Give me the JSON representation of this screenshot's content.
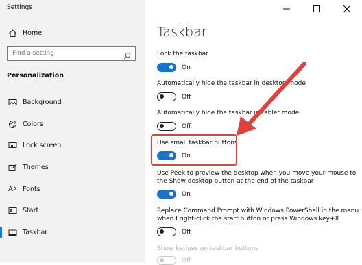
{
  "app": {
    "title": "Settings"
  },
  "sidebar": {
    "home_label": "Home",
    "search_placeholder": "Find a setting",
    "section_label": "Personalization",
    "items": [
      {
        "label": "Background",
        "icon": "image-icon"
      },
      {
        "label": "Colors",
        "icon": "palette-icon"
      },
      {
        "label": "Lock screen",
        "icon": "monitor-icon"
      },
      {
        "label": "Themes",
        "icon": "brush-icon"
      },
      {
        "label": "Fonts",
        "icon": "font-icon"
      },
      {
        "label": "Start",
        "icon": "start-icon"
      },
      {
        "label": "Taskbar",
        "icon": "taskbar-icon",
        "active": true
      }
    ]
  },
  "window_controls": [
    "minimize",
    "maximize",
    "close"
  ],
  "main": {
    "title": "Taskbar",
    "settings": [
      {
        "label": "Lock the taskbar",
        "state": "On"
      },
      {
        "label": "Automatically hide the taskbar in desktop mode",
        "state": "Off"
      },
      {
        "label": "Automatically hide the taskbar in tablet mode",
        "state": "Off"
      },
      {
        "label": "Use small taskbar buttons",
        "state": "On",
        "highlighted": true
      },
      {
        "label": "Use Peek to preview the desktop when you move your mouse to the Show desktop button at the end of the taskbar",
        "state": "On"
      },
      {
        "label": "Replace Command Prompt with Windows PowerShell in the menu when I right-click the start button or press Windows key+X",
        "state": "Off"
      },
      {
        "label": "Show badges on taskbar buttons",
        "state": "Off",
        "disabled": true
      }
    ]
  },
  "annotation": {
    "highlight_color": "#e0413b",
    "accent_color": "#1a73c8"
  }
}
